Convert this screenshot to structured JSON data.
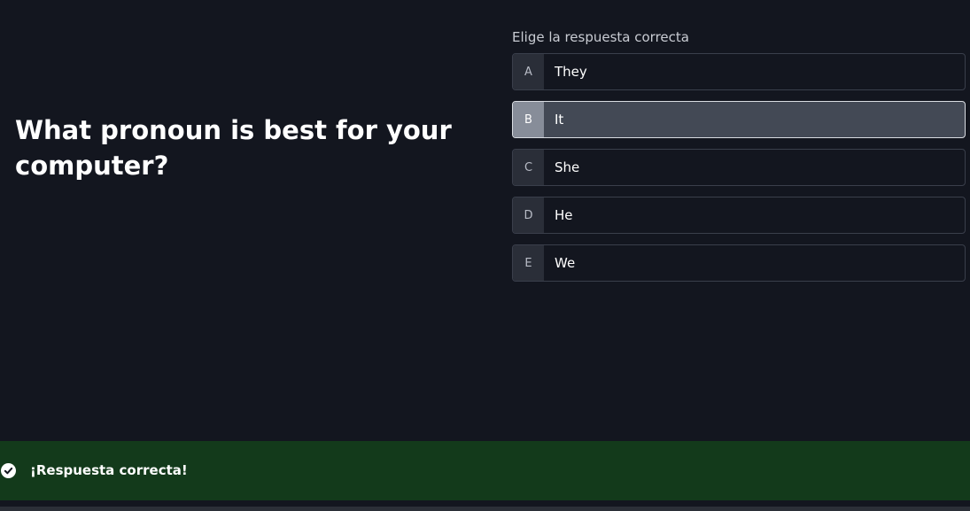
{
  "question": {
    "text": "What pronoun is best for your computer?"
  },
  "instruction": "Elige la respuesta correcta",
  "options": [
    {
      "letter": "A",
      "text": "They",
      "selected": false
    },
    {
      "letter": "B",
      "text": "It",
      "selected": true
    },
    {
      "letter": "C",
      "text": "She",
      "selected": false
    },
    {
      "letter": "D",
      "text": "He",
      "selected": false
    },
    {
      "letter": "E",
      "text": "We",
      "selected": false
    }
  ],
  "feedback": {
    "icon": "check-circle-icon",
    "text": "¡Respuesta correcta!",
    "color": "#133a1b"
  },
  "colors": {
    "background": "#13161f",
    "selected_option": "#434955"
  }
}
